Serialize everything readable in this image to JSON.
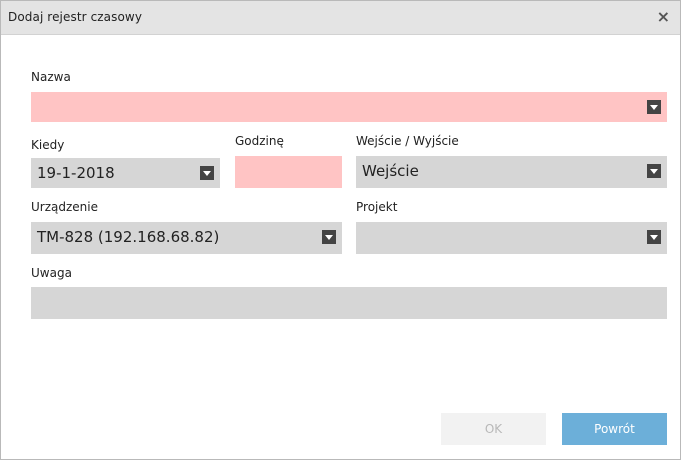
{
  "dialog": {
    "title": "Dodaj rejestr czasowy",
    "close_label": "×"
  },
  "fields": {
    "nazwa": {
      "label": "Nazwa",
      "value": ""
    },
    "kiedy": {
      "label": "Kiedy",
      "value": "19-1-2018"
    },
    "godzine": {
      "label": "Godzinę",
      "value": ""
    },
    "wejscie": {
      "label": "Wejście / Wyjście",
      "value": "Wejście"
    },
    "urzadzenie": {
      "label": "Urządzenie",
      "value": "TM-828 (192.168.68.82)"
    },
    "projekt": {
      "label": "Projekt",
      "value": ""
    },
    "uwaga": {
      "label": "Uwaga",
      "value": ""
    }
  },
  "buttons": {
    "ok": "OK",
    "back": "Powrót"
  },
  "colors": {
    "required_field": "#ffc4c4",
    "field": "#d6d6d6",
    "primary_button": "#6cafd9"
  }
}
